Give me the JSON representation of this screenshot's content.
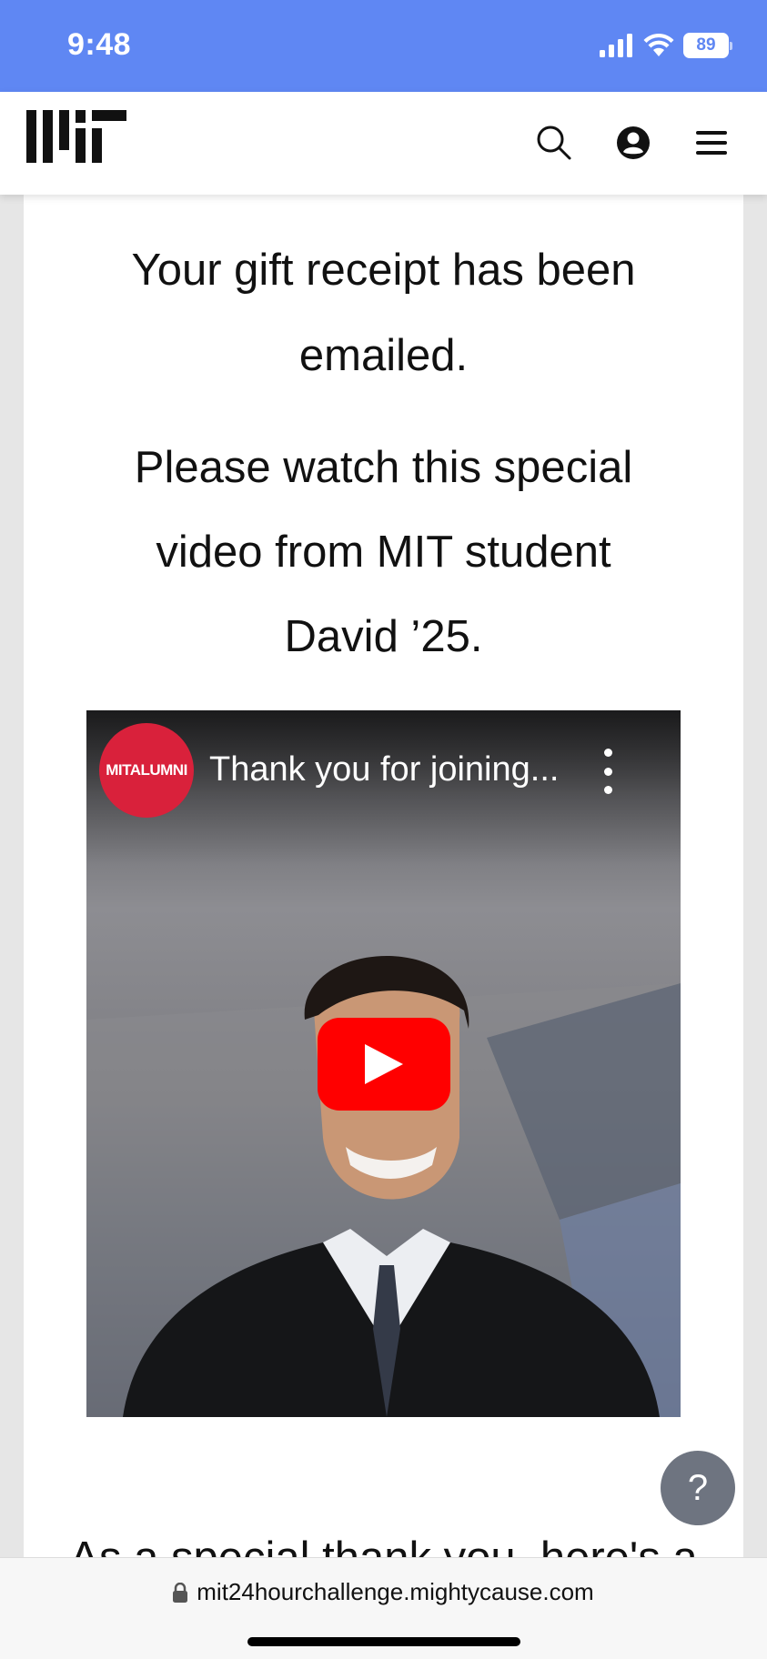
{
  "status_bar": {
    "time": "9:48",
    "battery": "89",
    "signal_icon": "cellular-signal-icon",
    "wifi_icon": "wifi-icon"
  },
  "header": {
    "logo_text": "MIT",
    "search_icon": "search-icon",
    "account_icon": "user-circle-icon",
    "menu_icon": "hamburger-menu-icon"
  },
  "content": {
    "receipt_message": "Your gift receipt has been emailed.",
    "video_intro_line1": "Please watch this special",
    "video_intro_line2": "video from MIT student",
    "video_intro_line3": "David ’25.",
    "truncated_text": "As a special thank you, here's a"
  },
  "video": {
    "channel_badge": "MITALUMNI",
    "title": "Thank you for joining...",
    "play_icon": "play-icon",
    "more_icon": "more-vertical-icon"
  },
  "help": {
    "label": "?"
  },
  "browser": {
    "url": "mit24hourchallenge.mightycause.com",
    "lock_icon": "lock-icon"
  },
  "colors": {
    "status_bar": "#5f87f3",
    "play_button": "#ff0000",
    "channel_badge": "#d9213b",
    "help_button": "#6e7480"
  }
}
